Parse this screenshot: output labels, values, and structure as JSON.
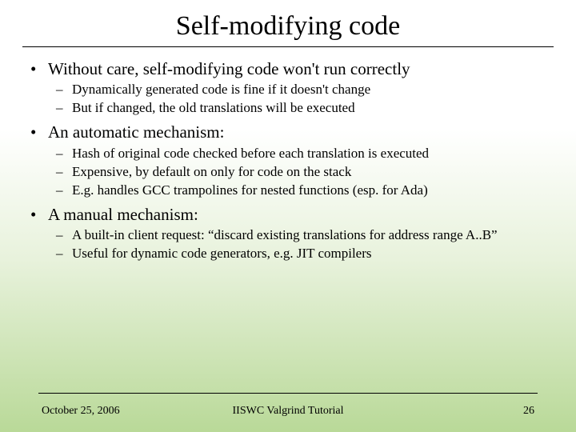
{
  "title": "Self-modifying code",
  "bullets": [
    {
      "text": "Without care, self-modifying code won't run correctly",
      "sub": [
        "Dynamically generated code is fine if it doesn't change",
        "But if changed, the old translations will be executed"
      ]
    },
    {
      "text": "An automatic mechanism:",
      "sub": [
        "Hash of original code checked before each translation is executed",
        "Expensive, by default on only for code on the stack",
        "E.g. handles GCC trampolines for nested functions (esp. for Ada)"
      ]
    },
    {
      "text": "A manual mechanism:",
      "sub": [
        "A built-in client request: “discard existing translations for address range A..B”",
        "Useful for dynamic code generators, e.g. JIT compilers"
      ]
    }
  ],
  "footer": {
    "date": "October 25, 2006",
    "center": "IISWC Valgrind Tutorial",
    "page": "26"
  }
}
